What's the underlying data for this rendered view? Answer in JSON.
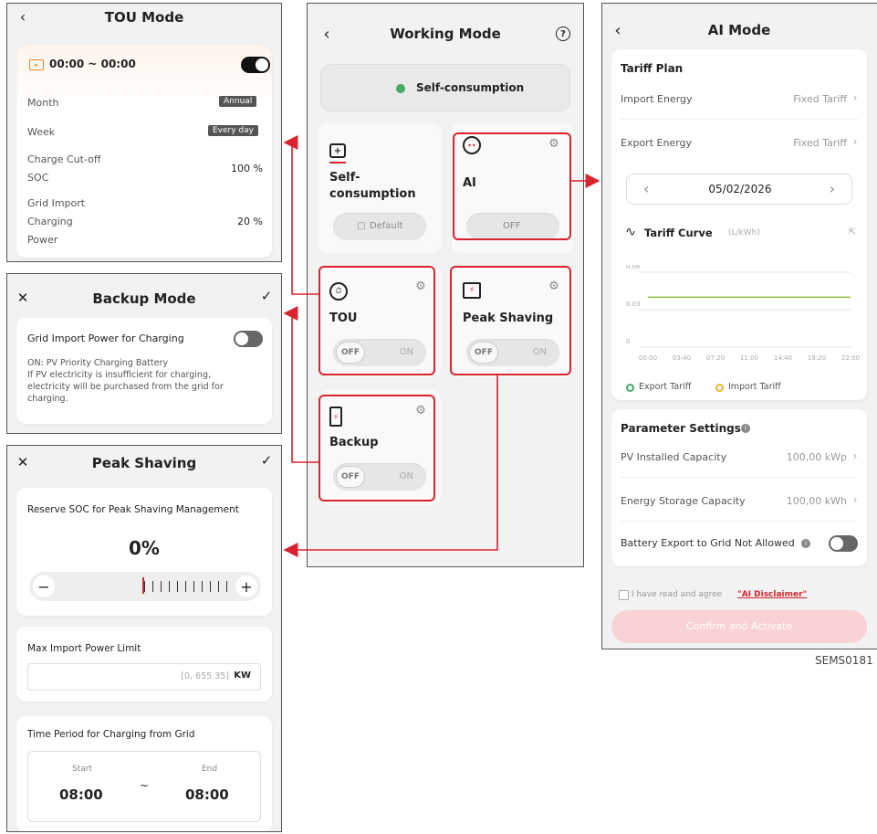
{
  "tou": {
    "title": "TOU Mode",
    "time": "00:00 ~ 00:00",
    "month_label": "Month",
    "month_value": "Annual",
    "week_label": "Week",
    "week_value": "Every day",
    "cutoff_l1": "Charge Cut-off",
    "cutoff_l2": "SOC",
    "cutoff_value": "100 %",
    "grid_l1": "Grid Import",
    "grid_l2": "Charging",
    "grid_l3": "Power",
    "grid_value": "20 %"
  },
  "backup": {
    "title": "Backup Mode",
    "label": "Grid Import Power for Charging",
    "desc1": "ON: PV Priority Charging Battery",
    "desc2": "If PV electricity is insufficient for charging,",
    "desc3": "electricity will be purchased from the grid for",
    "desc4": "charging."
  },
  "peak": {
    "title": "Peak Shaving",
    "reserve_label": "Reserve SOC for Peak Shaving Management",
    "percent": "0%",
    "max_import_label": "Max Import Power Limit",
    "max_import_placeholder": "[0, 655.35]",
    "max_import_unit": "KW",
    "period_label": "Time Period for Charging from Grid",
    "start_label": "Start",
    "start_time": "08:00",
    "tilde": "~",
    "end_label": "End",
    "end_time": "08:00"
  },
  "working": {
    "title": "Working Mode",
    "current": "Self-consumption",
    "selfc": {
      "line1": "Self-",
      "line2": "consumption",
      "btn": "Default"
    },
    "ai": {
      "label": "AI",
      "btn": "OFF"
    },
    "tou": {
      "label": "TOU",
      "off": "OFF",
      "on": "ON"
    },
    "peak": {
      "label": "Peak Shaving",
      "off": "OFF",
      "on": "ON"
    },
    "backup": {
      "label": "Backup",
      "off": "OFF",
      "on": "ON"
    }
  },
  "aimode": {
    "title": "AI Mode",
    "tariff_plan": "Tariff Plan",
    "import_label": "Import Energy",
    "import_value": "Fixed Tariff",
    "export_label": "Export Energy",
    "export_value": "Fixed Tariff",
    "date": "05/02/2026",
    "curve_title": "Tariff Curve",
    "curve_unit": "(L/kWh)",
    "legend_export": "Export Tariff",
    "legend_import": "Import Tariff",
    "param_title": "Parameter Settings",
    "pv_label": "PV Installed Capacity",
    "pv_value": "100,00 kWp",
    "storage_label": "Energy Storage Capacity",
    "storage_value": "100,00 kWh",
    "battery_label": "Battery Export to Grid Not Allowed",
    "agree_text": "I have read and agree",
    "disclaimer": "\"AI Disclaimer\"",
    "confirm": "Confirm and Activate"
  },
  "doc_code": "SEMS0181",
  "colors": {
    "accent_red": "#d9232e",
    "export_green": "#8bbd3a",
    "import_orange": "#f0b429"
  },
  "chart_data": {
    "type": "line",
    "x": [
      "00:00",
      "03:40",
      "07:20",
      "11:00",
      "14:40",
      "18:20",
      "22:00"
    ],
    "yticks": [
      "0",
      "0.03",
      "0.06"
    ],
    "ylim": [
      0,
      0.06
    ],
    "series": [
      {
        "name": "Export Tariff",
        "values": [
          0.04,
          0.04,
          0.04,
          0.04,
          0.04,
          0.04,
          0.04
        ]
      }
    ]
  }
}
